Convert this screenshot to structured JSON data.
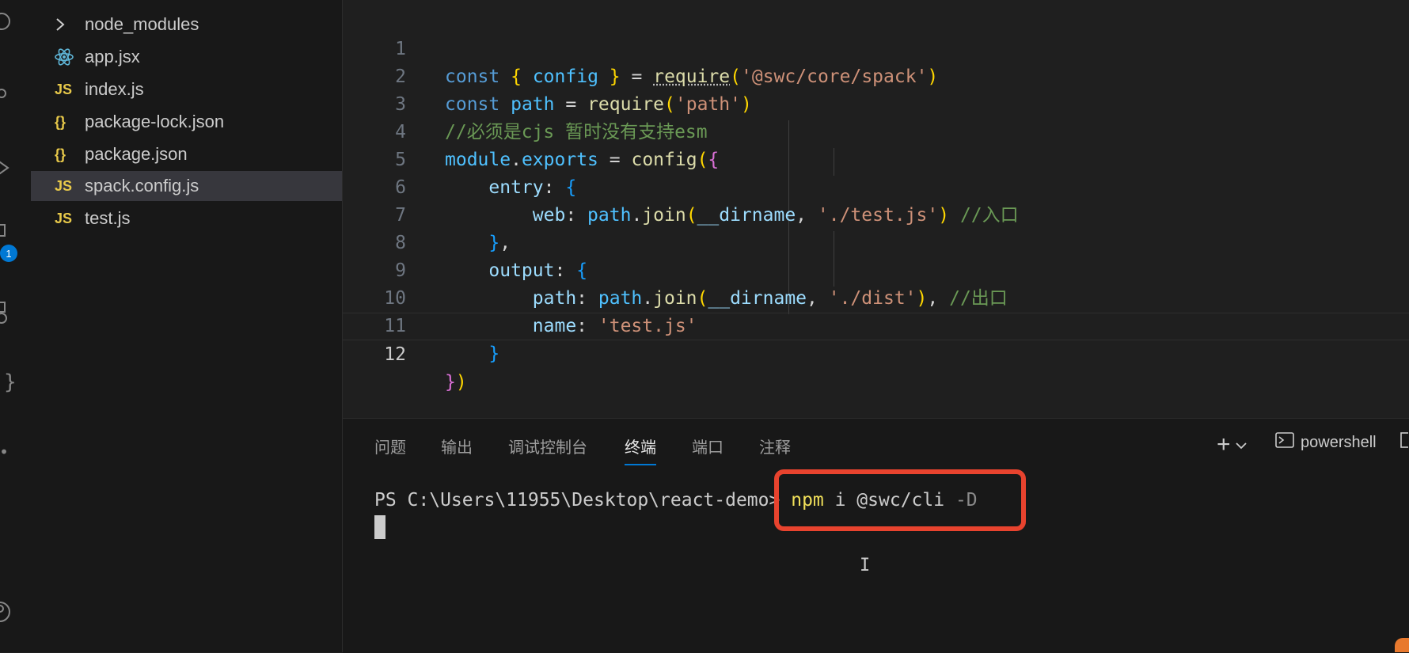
{
  "explorer": {
    "items": [
      {
        "name": "node_modules",
        "icon": "chevron-right"
      },
      {
        "name": "app.jsx",
        "icon": "react"
      },
      {
        "name": "index.js",
        "icon": "JS"
      },
      {
        "name": "package-lock.json",
        "icon": "{}"
      },
      {
        "name": "package.json",
        "icon": "{}"
      },
      {
        "name": "spack.config.js",
        "icon": "JS",
        "selected": true
      },
      {
        "name": "test.js",
        "icon": "JS"
      }
    ]
  },
  "activity": {
    "badge": "1"
  },
  "editor": {
    "line_numbers": [
      "1",
      "2",
      "3",
      "4",
      "5",
      "6",
      "7",
      "8",
      "9",
      "10",
      "11",
      "12"
    ],
    "current_line": "12",
    "lines": {
      "l1": {
        "kw": "const",
        "b_open": "{",
        "name": "config",
        "b_close": "}",
        "eq": "=",
        "fn": "require",
        "p_open": "(",
        "str": "'@swc/core/spack'",
        "p_close": ")"
      },
      "l2": {
        "kw": "const",
        "name": "path",
        "eq": "=",
        "fn": "require",
        "p_open": "(",
        "str": "'path'",
        "p_close": ")"
      },
      "l3": {
        "comment": "//必须是cjs 暂时没有支持esm"
      },
      "l4": {
        "obj": "module",
        "dot": ".",
        "prop": "exports",
        "eq": "=",
        "fn": "config",
        "p_open": "(",
        "b_open": "{"
      },
      "l5": {
        "key": "entry",
        "colon": ":",
        "b_open": "{"
      },
      "l6": {
        "key": "web",
        "colon": ":",
        "obj": "path",
        "dot": ".",
        "fn": "join",
        "p_open": "(",
        "arg": "__dirname",
        "comma": ",",
        "str": "'./test.js'",
        "p_close": ")",
        "comment": "//入口"
      },
      "l7": {
        "b_close": "}",
        "comma": ","
      },
      "l8": {
        "key": "output",
        "colon": ":",
        "b_open": "{"
      },
      "l9": {
        "key": "path",
        "colon": ":",
        "obj": "path",
        "dot": ".",
        "fn": "join",
        "p_open": "(",
        "arg": "__dirname",
        "comma": ",",
        "str": "'./dist'",
        "p_close": ")",
        "comma2": ",",
        "comment": "//出口"
      },
      "l10": {
        "key": "name",
        "colon": ":",
        "str": "'test.js'"
      },
      "l11": {
        "b_close": "}"
      },
      "l12": {
        "b_close": "}",
        "p_close": ")"
      }
    }
  },
  "panel": {
    "tabs": [
      "问题",
      "输出",
      "调试控制台",
      "终端",
      "端口",
      "注释"
    ],
    "active_tab": "终端",
    "add_label": "+",
    "shell_label": "powershell",
    "terminal": {
      "prompt": "PS C:\\Users\\11955\\Desktop\\react-demo>",
      "cmd": "npm",
      "args": " i @swc/cli ",
      "flag": "-D"
    }
  },
  "colors": {
    "highlight_box": "#e8432e",
    "accent": "#0078d4"
  }
}
